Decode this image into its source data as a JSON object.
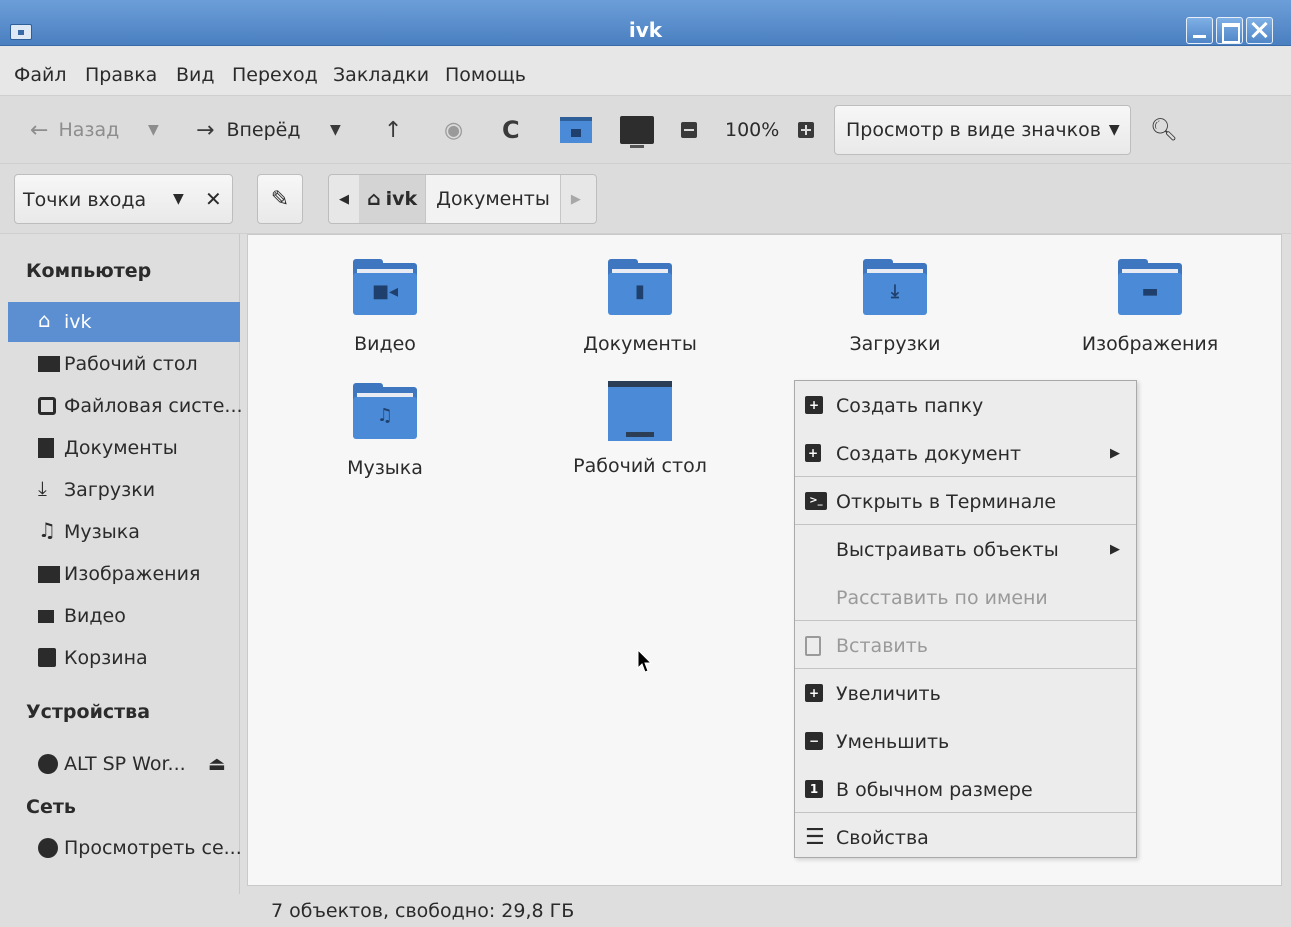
{
  "window": {
    "title": "ivk"
  },
  "menubar": [
    "Файл",
    "Правка",
    "Вид",
    "Переход",
    "Закладки",
    "Помощь"
  ],
  "toolbar": {
    "back_label": "Назад",
    "forward_label": "Вперёд",
    "zoom_level": "100%",
    "view_mode": "Просмотр в виде значков"
  },
  "location": {
    "places_label": "Точки входа",
    "path_home": "ivk",
    "path_current": "Документы"
  },
  "sidebar": {
    "computer_header": "Компьютер",
    "items": [
      {
        "label": "ivk",
        "icon": "home-icon"
      },
      {
        "label": "Рабочий стол",
        "icon": "desktop-icon"
      },
      {
        "label": "Файловая систе...",
        "icon": "drive-icon"
      },
      {
        "label": "Документы",
        "icon": "document-icon"
      },
      {
        "label": "Загрузки",
        "icon": "download-icon"
      },
      {
        "label": "Музыка",
        "icon": "music-icon"
      },
      {
        "label": "Изображения",
        "icon": "image-icon"
      },
      {
        "label": "Видео",
        "icon": "video-icon"
      },
      {
        "label": "Корзина",
        "icon": "trash-icon"
      }
    ],
    "devices_header": "Устройства",
    "device": "ALT SP Wor...",
    "network_header": "Сеть",
    "network_item": "Просмотреть се..."
  },
  "files": [
    {
      "name": "Видео",
      "icon": "video-folder-icon"
    },
    {
      "name": "Документы",
      "icon": "documents-folder-icon"
    },
    {
      "name": "Загрузки",
      "icon": "downloads-folder-icon"
    },
    {
      "name": "Изображения",
      "icon": "pictures-folder-icon"
    },
    {
      "name": "Музыка",
      "icon": "music-folder-icon"
    },
    {
      "name": "Рабочий стол",
      "icon": "desktop-folder-icon"
    }
  ],
  "context_menu": [
    {
      "label": "Создать папку",
      "icon": "new-folder-icon",
      "enabled": true
    },
    {
      "label": "Создать документ",
      "icon": "new-document-icon",
      "enabled": true,
      "submenu": true
    },
    {
      "label": "Открыть в Терминале",
      "icon": "terminal-icon",
      "enabled": true
    },
    {
      "label": "Выстраивать объекты",
      "enabled": true,
      "submenu": true
    },
    {
      "label": "Расставить по имени",
      "enabled": false
    },
    {
      "label": "Вставить",
      "icon": "paste-icon",
      "enabled": false
    },
    {
      "label": "Увеличить",
      "icon": "zoom-in-icon",
      "enabled": true
    },
    {
      "label": "Уменьшить",
      "icon": "zoom-out-icon",
      "enabled": true
    },
    {
      "label": "В обычном размере",
      "icon": "zoom-normal-icon",
      "enabled": true
    },
    {
      "label": "Свойства",
      "icon": "properties-icon",
      "enabled": true
    }
  ],
  "status": "7 объектов, свободно: 29,8 ГБ",
  "colors": {
    "accent": "#5b8fd1",
    "folder": "#4a8ad6",
    "titlebar": "#4a7fc0"
  }
}
